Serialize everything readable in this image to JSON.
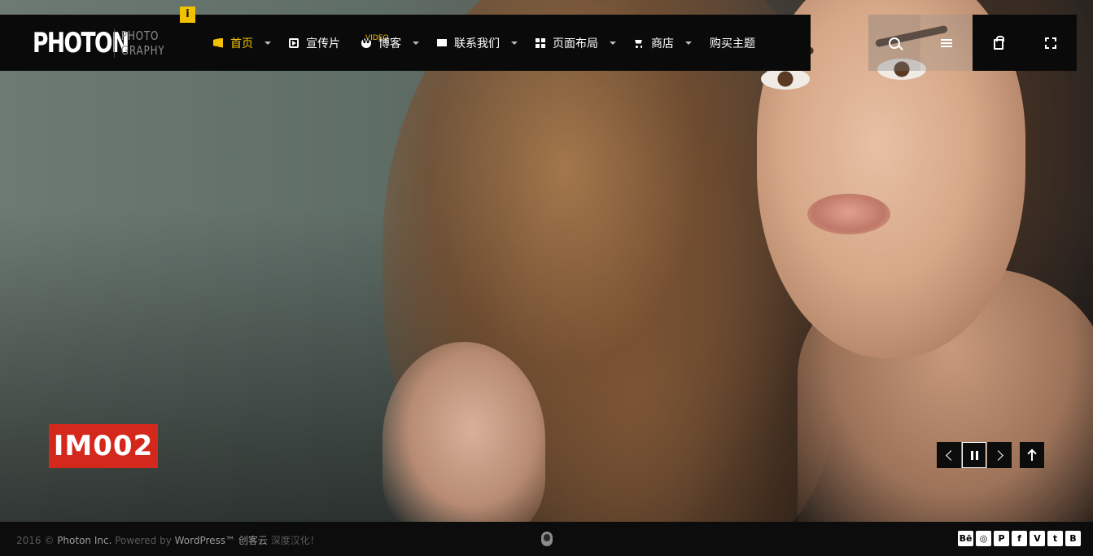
{
  "brand": {
    "name": "PHOTON",
    "sub_line1": "PHOTO",
    "sub_line2": "GRAPHY",
    "info_badge": "i"
  },
  "nav": {
    "items": [
      {
        "label": "首页",
        "icon": "home-icon",
        "has_dropdown": true,
        "active": true
      },
      {
        "label": "宣传片",
        "icon": "video-play-icon",
        "has_dropdown": false,
        "tag": "VIDEO"
      },
      {
        "label": "博客",
        "icon": "wordpress-icon",
        "has_dropdown": true
      },
      {
        "label": "联系我们",
        "icon": "envelope-icon",
        "has_dropdown": true
      },
      {
        "label": "页面布局",
        "icon": "grid-icon",
        "has_dropdown": true
      },
      {
        "label": "商店",
        "icon": "cart-icon",
        "has_dropdown": true
      },
      {
        "label": "购买主题",
        "icon": null,
        "has_dropdown": false
      }
    ],
    "active_color": "#f2c100"
  },
  "tools": [
    "search-icon",
    "menu-icon",
    "shopping-bag-icon",
    "fullscreen-icon"
  ],
  "slide": {
    "title": "IM002",
    "title_bg": "#d5281c"
  },
  "slider_controls": [
    "prev-arrow-icon",
    "pause-icon",
    "next-arrow-icon",
    "scroll-top-icon"
  ],
  "footer": {
    "year": "2016 ©",
    "company": "Photon Inc.",
    "powered": "Powered by",
    "platform": "WordPress™",
    "translator": "创客云",
    "suffix": "深度汉化！"
  },
  "socials": [
    {
      "icon": "behance-icon",
      "glyph": "Bē"
    },
    {
      "icon": "dribbble-icon",
      "glyph": "◎"
    },
    {
      "icon": "pinterest-icon",
      "glyph": "P"
    },
    {
      "icon": "facebook-icon",
      "glyph": "f"
    },
    {
      "icon": "vimeo-icon",
      "glyph": "V"
    },
    {
      "icon": "twitter-icon",
      "glyph": "t"
    },
    {
      "icon": "blogger-icon",
      "glyph": "B"
    }
  ]
}
